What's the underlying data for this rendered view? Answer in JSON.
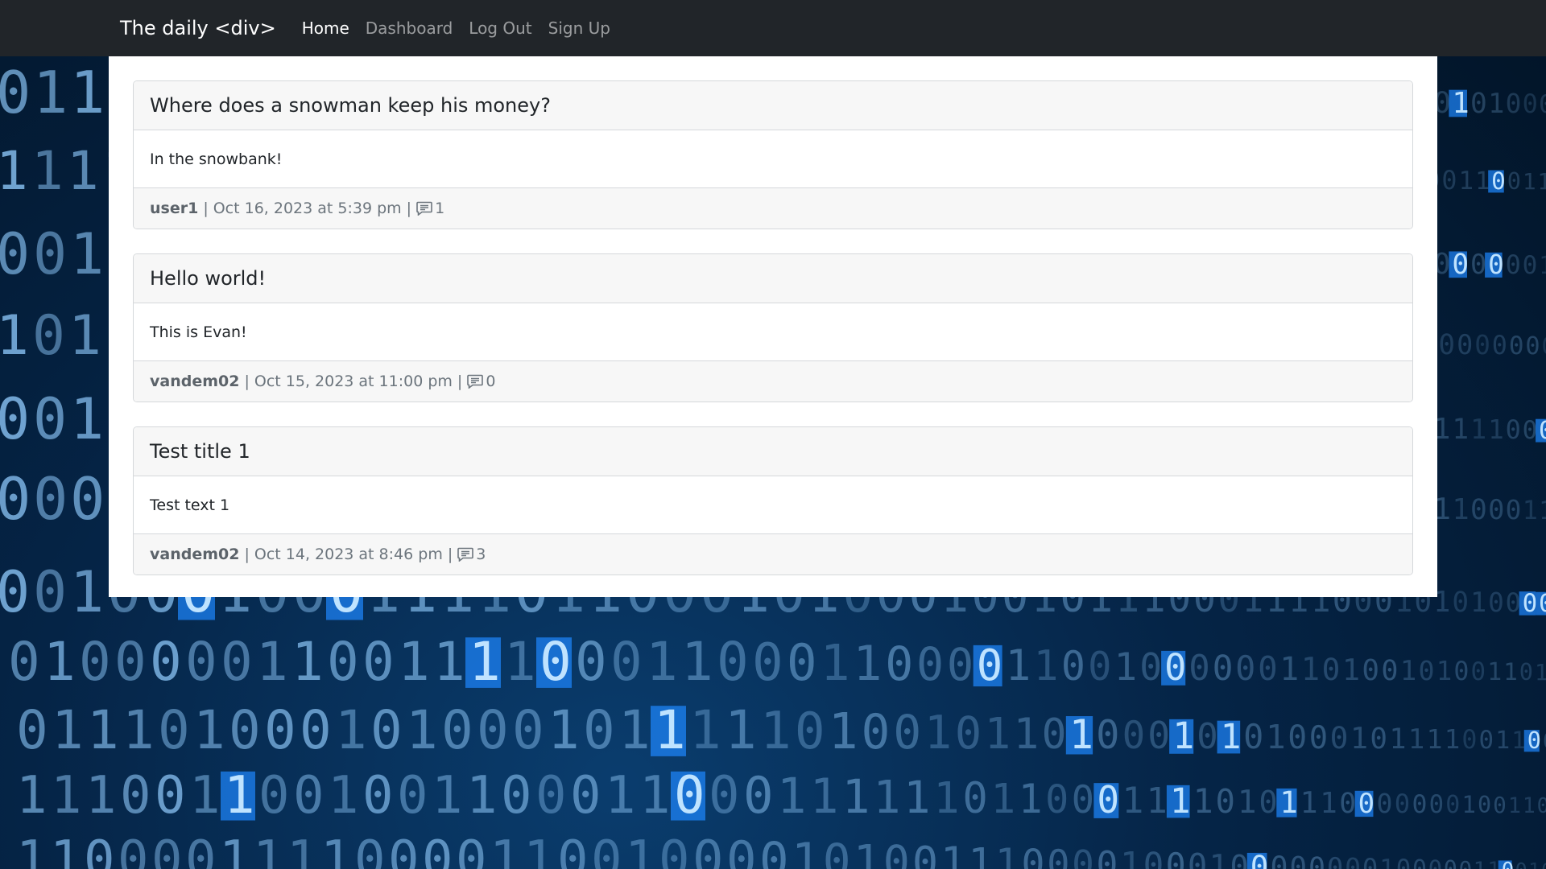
{
  "navbar": {
    "brand": "The daily <div>",
    "links": [
      {
        "label": "Home",
        "active": true
      },
      {
        "label": "Dashboard",
        "active": false
      },
      {
        "label": "Log Out",
        "active": false
      },
      {
        "label": "Sign Up",
        "active": false
      }
    ]
  },
  "posts": [
    {
      "title": "Where does a snowman keep his money?",
      "body": "In the snowbank!",
      "author": "user1",
      "date": "Oct 16, 2023 at 5:39 pm",
      "comments": "1"
    },
    {
      "title": "Hello world!",
      "body": "This is Evan!",
      "author": "vandem02",
      "date": "Oct 15, 2023 at 11:00 pm",
      "comments": "0"
    },
    {
      "title": "Test title 1",
      "body": "Test text 1",
      "author": "vandem02",
      "date": "Oct 14, 2023 at 8:46 pm",
      "comments": "3"
    }
  ],
  "footer_separator": "|",
  "icons": {
    "comment": "comment-icon"
  },
  "colors": {
    "navbar_bg": "#212529",
    "background": "#052446",
    "binary_digits": "#7fb6e6",
    "highlight": "#1e88ff"
  }
}
